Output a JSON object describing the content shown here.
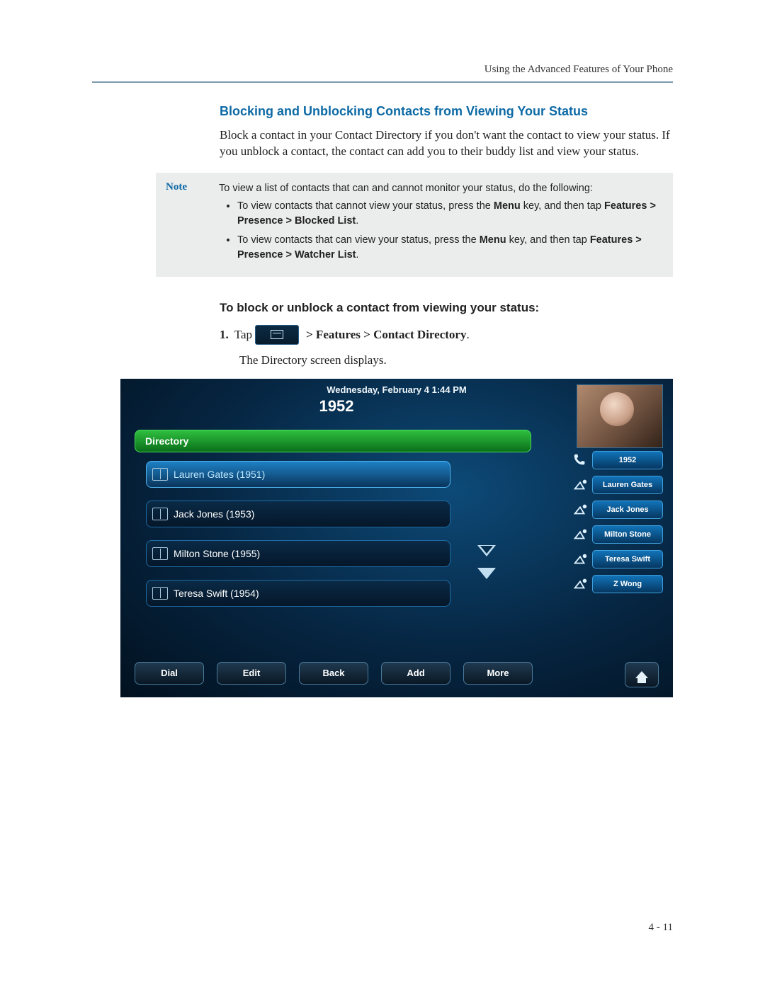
{
  "running_head": "Using the Advanced Features of Your Phone",
  "section_title": "Blocking and Unblocking Contacts from Viewing Your Status",
  "intro_para": "Block a contact in your Contact Directory if you don't want the contact to view your status. If you unblock a contact, the contact can add you to their buddy list and view your status.",
  "note": {
    "label": "Note",
    "lead": "To view a list of contacts that can and cannot monitor your status, do the following:",
    "bullets": [
      {
        "pre": "To view contacts that cannot view your status, press the ",
        "key": "Menu",
        "mid": " key, and then tap ",
        "path": "Features > Presence > Blocked List",
        "post": "."
      },
      {
        "pre": "To view contacts that can view your status, press the ",
        "key": "Menu",
        "mid": " key, and then tap ",
        "path": "Features > Presence > Watcher List",
        "post": "."
      }
    ]
  },
  "procedure_title": "To block or unblock a contact from viewing your status:",
  "step1": {
    "num": "1.",
    "tap": "Tap",
    "path": " > Features > Contact Directory",
    "period": ".",
    "followup": "The Directory screen displays."
  },
  "phone": {
    "datetime": "Wednesday, February 4  1:44 PM",
    "line": "1952",
    "dir_header": "Directory",
    "entries": [
      {
        "name": "Lauren Gates",
        "ext": "1951",
        "selected": true
      },
      {
        "name": "Jack Jones",
        "ext": "1953",
        "selected": false
      },
      {
        "name": "Milton Stone",
        "ext": "1955",
        "selected": false
      },
      {
        "name": "Teresa Swift",
        "ext": "1954",
        "selected": false
      }
    ],
    "side": [
      {
        "label": "1952",
        "icon": "handset"
      },
      {
        "label": "Lauren Gates",
        "icon": "presence"
      },
      {
        "label": "Jack Jones",
        "icon": "presence"
      },
      {
        "label": "Milton Stone",
        "icon": "presence"
      },
      {
        "label": "Teresa Swift",
        "icon": "presence"
      },
      {
        "label": "Z Wong",
        "icon": "presence"
      }
    ],
    "softkeys": [
      "Dial",
      "Edit",
      "Back",
      "Add",
      "More"
    ]
  },
  "page_number": "4 - 11"
}
